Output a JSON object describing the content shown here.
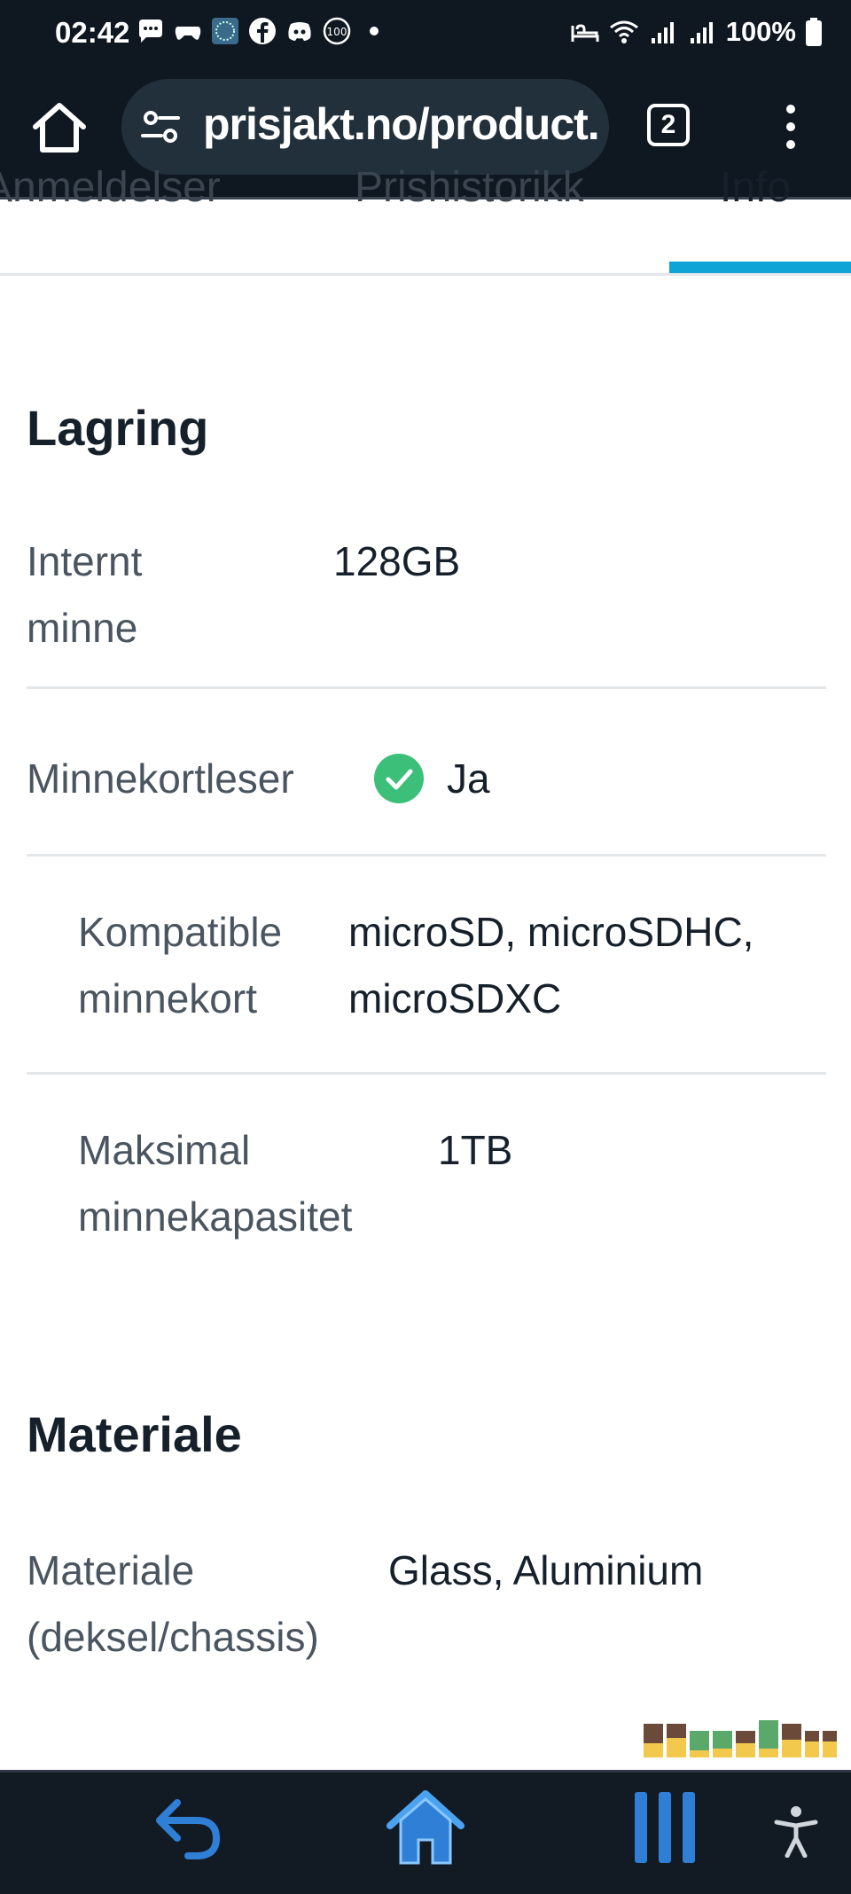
{
  "status_bar": {
    "time": "02:42",
    "battery": "100%"
  },
  "browser": {
    "url": "prisjakt.no/product.",
    "tab_count": "2"
  },
  "tabs": [
    {
      "label": "Anmeldelser"
    },
    {
      "label": "Prishistorikk"
    },
    {
      "label": "Info"
    }
  ],
  "sections": {
    "storage": {
      "title": "Lagring",
      "internal_memory_label_1": "Internt",
      "internal_memory_label_2": "minne",
      "internal_memory_value": "128GB",
      "card_reader_label": "Minnekortleser",
      "card_reader_value": "Ja",
      "compatible_label_1": "Kompatible",
      "compatible_label_2": "minnekort",
      "compatible_value_1": "microSD, microSDHC,",
      "compatible_value_2": "microSDXC",
      "max_capacity_label_1": "Maksimal",
      "max_capacity_label_2": "minnekapasitet",
      "max_capacity_value": "1TB"
    },
    "material": {
      "title": "Materiale",
      "material_label_1": "Materiale",
      "material_label_2": "(deksel/chassis)",
      "material_value": "Glass, Aluminium"
    }
  },
  "colors": {
    "accent": "#0ea5d6",
    "check_green": "#3cbf79",
    "chrome_bg": "#0f1720"
  }
}
